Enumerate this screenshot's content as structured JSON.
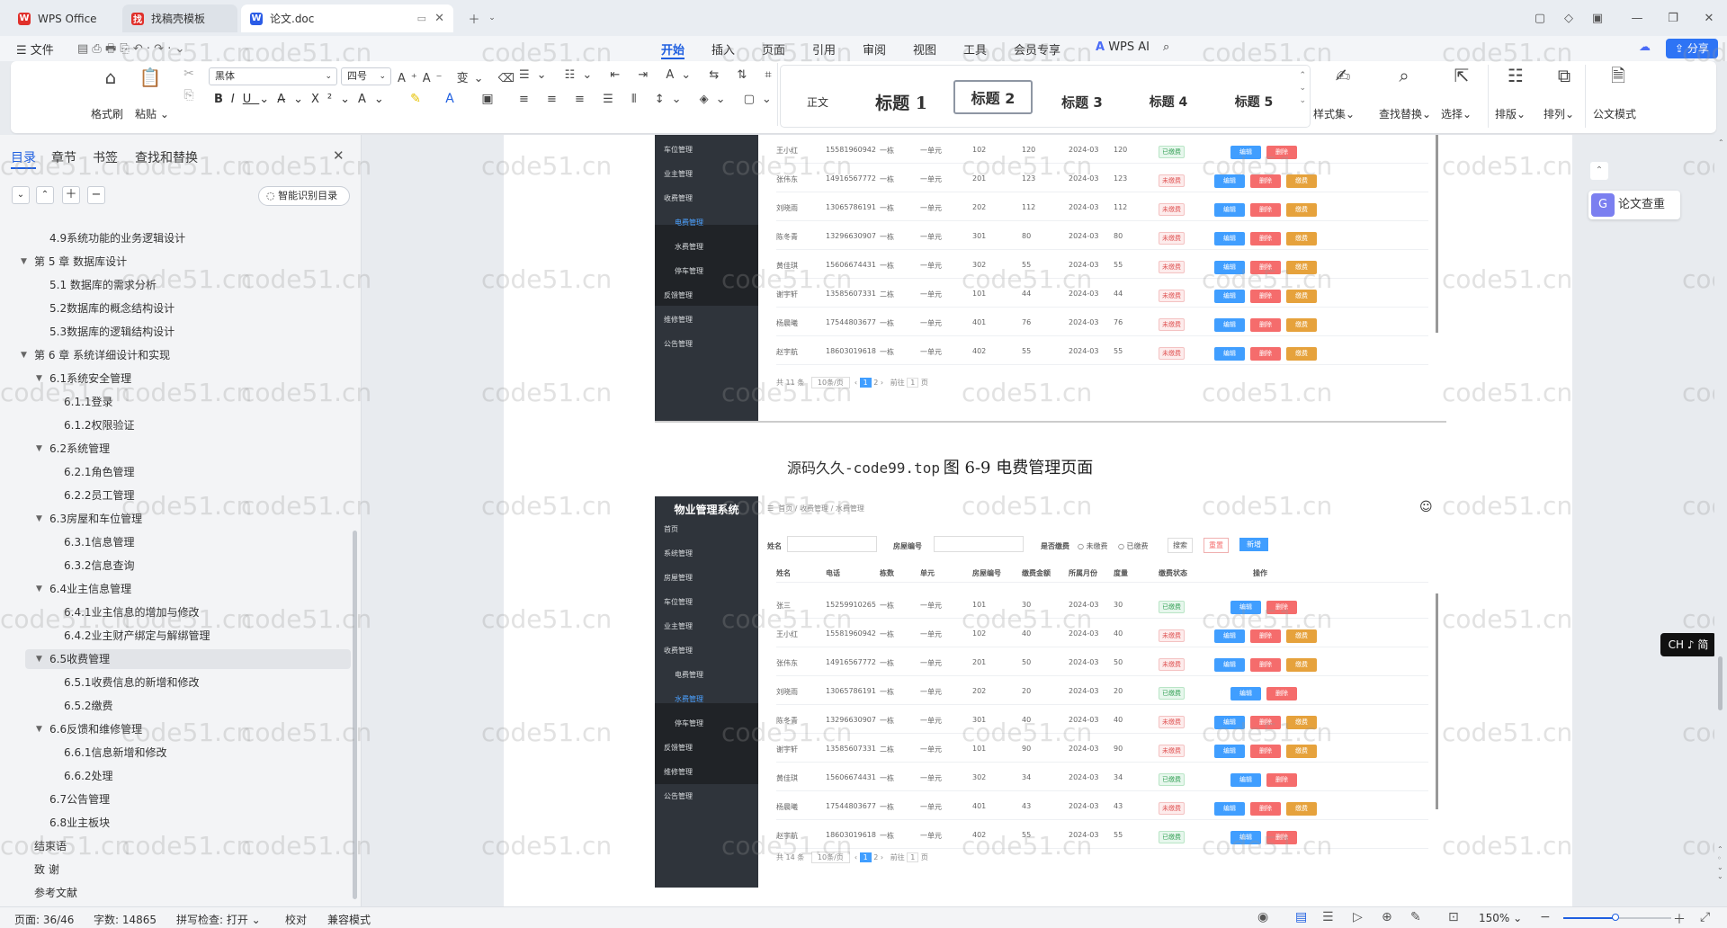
{
  "tabs": [
    {
      "label": "WPS Office",
      "icon": "wps-logo-icon"
    },
    {
      "label": "找稿壳模板",
      "icon": "template-icon"
    },
    {
      "label": "论文.doc",
      "icon": "word-doc-icon"
    }
  ],
  "menu": {
    "file": "文件",
    "tabs": [
      "开始",
      "插入",
      "页面",
      "引用",
      "审阅",
      "视图",
      "工具",
      "会员专享"
    ],
    "wps_ai": "WPS AI",
    "share": "分享"
  },
  "ribbon": {
    "format_painter": "格式刷",
    "paste": "粘贴",
    "font_name": "黑体",
    "font_size": "四号",
    "styles": [
      "正文",
      "标题 1",
      "标题 2",
      "标题 3",
      "标题 4",
      "标题 5"
    ],
    "style_set": "样式集",
    "find_replace": "查找替换",
    "select": "选择",
    "layout": "排版",
    "arrange": "排列",
    "official_mode": "公文模式"
  },
  "panel": {
    "tabs": [
      "目录",
      "章节",
      "书签",
      "查找和替换"
    ],
    "smart_toc": "智能识别目录",
    "toc": [
      {
        "text": "4.9系统功能的业务逻辑设计",
        "level": 2,
        "caret": false
      },
      {
        "text": "第 5 章    数据库设计",
        "level": 1,
        "caret": true
      },
      {
        "text": "5.1  数据库的需求分析",
        "level": 2,
        "caret": false
      },
      {
        "text": "5.2数据库的概念结构设计",
        "level": 2,
        "caret": false
      },
      {
        "text": "5.3数据库的逻辑结构设计",
        "level": 2,
        "caret": false
      },
      {
        "text": "第 6 章    系统详细设计和实现",
        "level": 1,
        "caret": true
      },
      {
        "text": "6.1系统安全管理",
        "level": 2,
        "caret": true
      },
      {
        "text": "6.1.1登录",
        "level": 3,
        "caret": false
      },
      {
        "text": "6.1.2权限验证",
        "level": 3,
        "caret": false
      },
      {
        "text": "6.2系统管理",
        "level": 2,
        "caret": true
      },
      {
        "text": "6.2.1角色管理",
        "level": 3,
        "caret": false
      },
      {
        "text": "6.2.2员工管理",
        "level": 3,
        "caret": false
      },
      {
        "text": "6.3房屋和车位管理",
        "level": 2,
        "caret": true
      },
      {
        "text": "6.3.1信息管理",
        "level": 3,
        "caret": false
      },
      {
        "text": "6.3.2信息查询",
        "level": 3,
        "caret": false
      },
      {
        "text": "6.4业主信息管理",
        "level": 2,
        "caret": true
      },
      {
        "text": "6.4.1业主信息的增加与修改",
        "level": 3,
        "caret": false
      },
      {
        "text": "6.4.2业主财产绑定与解绑管理",
        "level": 3,
        "caret": false
      },
      {
        "text": "6.5收费管理",
        "level": 2,
        "caret": true,
        "highlight": true
      },
      {
        "text": "6.5.1收费信息的新增和修改",
        "level": 3,
        "caret": false
      },
      {
        "text": "6.5.2缴费",
        "level": 3,
        "caret": false
      },
      {
        "text": "6.6反馈和维修管理",
        "level": 2,
        "caret": true
      },
      {
        "text": "6.6.1信息新增和修改",
        "level": 3,
        "caret": false
      },
      {
        "text": "6.6.2处理",
        "level": 3,
        "caret": false
      },
      {
        "text": "6.7公告管理",
        "level": 2,
        "caret": false
      },
      {
        "text": "6.8业主板块",
        "level": 2,
        "caret": false
      },
      {
        "text": "结束语",
        "level": 0,
        "caret": false
      },
      {
        "text": "致    谢",
        "level": 0,
        "caret": false
      },
      {
        "text": "参考文献",
        "level": 0,
        "caret": false
      }
    ]
  },
  "doc": {
    "caption_prefix": "源码久久-code99.top",
    "caption": "图 6-9  电费管理页面",
    "watermark": "code51.cn",
    "fig1": {
      "nav": [
        "车位管理",
        "业主管理",
        "收费管理",
        "电费管理",
        "水费管理",
        "停车管理",
        "反馈管理",
        "维修管理",
        "公告管理"
      ],
      "rows": [
        [
          "王小红",
          "15581960942",
          "一栋",
          "一单元",
          "102",
          "120",
          "2024-03",
          "120",
          "已缴费"
        ],
        [
          "张伟东",
          "14916567772",
          "一栋",
          "一单元",
          "201",
          "123",
          "2024-03",
          "123",
          "未缴费"
        ],
        [
          "刘晓雨",
          "13065786191",
          "一栋",
          "一单元",
          "202",
          "112",
          "2024-03",
          "112",
          "未缴费"
        ],
        [
          "陈冬青",
          "13296630907",
          "一栋",
          "一单元",
          "301",
          "80",
          "2024-03",
          "80",
          "未缴费"
        ],
        [
          "黄佳琪",
          "15606674431",
          "一栋",
          "一单元",
          "302",
          "55",
          "2024-03",
          "55",
          "未缴费"
        ],
        [
          "谢宇轩",
          "13585607331",
          "二栋",
          "一单元",
          "101",
          "44",
          "2024-03",
          "44",
          "未缴费"
        ],
        [
          "杨晨曦",
          "17544803677",
          "一栋",
          "一单元",
          "401",
          "76",
          "2024-03",
          "76",
          "未缴费"
        ],
        [
          "赵宇航",
          "18603019618",
          "一栋",
          "一单元",
          "402",
          "55",
          "2024-03",
          "55",
          "未缴费"
        ]
      ],
      "pager": "共 11 条"
    },
    "fig2": {
      "brand": "物业管理系统",
      "breadcrumb": "首页  /  收费管理  /  水费管理",
      "filters": [
        "姓名",
        "房屋编号",
        "是否缴费",
        "未缴费",
        "已缴费"
      ],
      "actions": [
        "搜索",
        "重置",
        "新增"
      ],
      "headers": [
        "姓名",
        "电话",
        "栋数",
        "单元",
        "房屋编号",
        "缴费金额",
        "所属月份",
        "度量",
        "缴费状态",
        "操作"
      ],
      "nav": [
        "首页",
        "系统管理",
        "房屋管理",
        "车位管理",
        "业主管理",
        "收费管理",
        "电费管理",
        "水费管理",
        "停车管理",
        "反馈管理",
        "维修管理",
        "公告管理"
      ],
      "rows": [
        [
          "张三",
          "15259910265",
          "一栋",
          "一单元",
          "101",
          "30",
          "2024-03",
          "30",
          "已缴费"
        ],
        [
          "王小红",
          "15581960942",
          "一栋",
          "一单元",
          "102",
          "40",
          "2024-03",
          "40",
          "未缴费"
        ],
        [
          "张伟东",
          "14916567772",
          "一栋",
          "一单元",
          "201",
          "50",
          "2024-03",
          "50",
          "未缴费"
        ],
        [
          "刘晓雨",
          "13065786191",
          "一栋",
          "一单元",
          "202",
          "20",
          "2024-03",
          "20",
          "已缴费"
        ],
        [
          "陈冬青",
          "13296630907",
          "一栋",
          "一单元",
          "301",
          "40",
          "2024-03",
          "40",
          "未缴费"
        ],
        [
          "谢宇轩",
          "13585607331",
          "二栋",
          "一单元",
          "101",
          "90",
          "2024-03",
          "90",
          "未缴费"
        ],
        [
          "黄佳琪",
          "15606674431",
          "一栋",
          "一单元",
          "302",
          "34",
          "2024-03",
          "34",
          "已缴费"
        ],
        [
          "杨晨曦",
          "17544803677",
          "一栋",
          "一单元",
          "401",
          "43",
          "2024-03",
          "43",
          "未缴费"
        ],
        [
          "赵宇航",
          "18603019618",
          "一栋",
          "一单元",
          "402",
          "55",
          "2024-03",
          "55",
          "已缴费"
        ]
      ],
      "pager": "共 14 条"
    },
    "buttons": {
      "edit": "编辑",
      "delete": "删除",
      "pay": "缴费"
    },
    "page_size": "10条/页",
    "goto": "前往",
    "page_unit": "页",
    "page_input": "1"
  },
  "right": {
    "paper_check": "论文查重",
    "ime": "CH ♪ 简"
  },
  "status": {
    "page": "页面: 36/46",
    "words": "字数: 14865",
    "spell": "拼写检查: 打开",
    "proof": "校对",
    "compat": "兼容模式",
    "zoom": "150%"
  },
  "colors": {
    "accent": "#1f5fe0",
    "edit": "#409eff",
    "delete": "#f56c6c",
    "pay": "#e6a23c",
    "sidebar_dark": "#2f343b"
  }
}
